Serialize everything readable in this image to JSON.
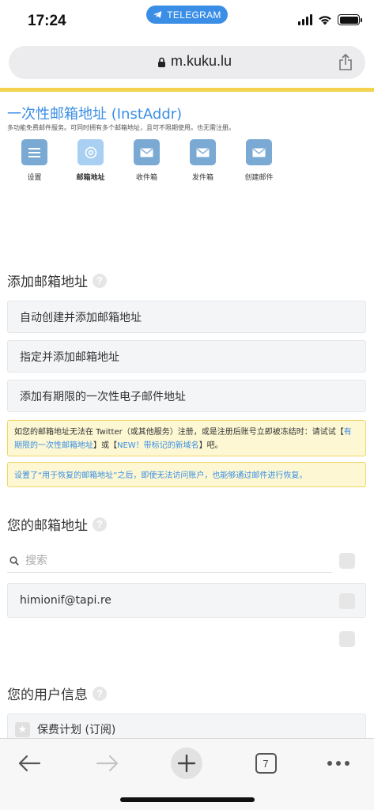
{
  "status_bar": {
    "time": "17:24",
    "telegram_label": "TELEGRAM",
    "battery_level": 1.0
  },
  "browser": {
    "url": "m.kuku.lu",
    "tab_count": "7"
  },
  "header": {
    "title": "一次性邮箱地址 (InstAddr)",
    "subtitle": "多功能免费邮件服务。可同时拥有多个邮箱地址，且可不限期使用。也无需注册。"
  },
  "nav": [
    {
      "label": "设置",
      "icon": "menu-icon"
    },
    {
      "label": "邮箱地址",
      "icon": "at-icon"
    },
    {
      "label": "收件箱",
      "icon": "mail-icon"
    },
    {
      "label": "发件箱",
      "icon": "mail-icon"
    },
    {
      "label": "创建邮件",
      "icon": "mail-icon"
    }
  ],
  "add_section": {
    "heading": "添加邮箱地址",
    "buttons": [
      "自动创建并添加邮箱地址",
      "指定并添加邮箱地址",
      "添加有期限的一次性电子邮件地址"
    ]
  },
  "notices": {
    "first_prefix": "如您的邮箱地址无法在 Twitter（或其他服务）注册，或是注册后账号立即被冻结时：请试试【",
    "first_link1": "有期限的一次性邮箱地址",
    "first_middle": "】或【",
    "first_link2": "NEW！带标记的新域名",
    "first_suffix": "】吧。",
    "second": "设置了“用于恢复的邮箱地址”之后，即使无法访问账户，也能够通过邮件进行恢复。"
  },
  "mailbox_section": {
    "heading": "您的邮箱地址",
    "search_placeholder": "搜索",
    "emails": [
      "himionif@tapi.re"
    ]
  },
  "user_section": {
    "heading": "您的用户信息",
    "plan_label": "保费计划 (订阅)"
  },
  "colors": {
    "accent": "#3a8ee6",
    "yellow_bar": "#f3d250",
    "notice_bg": "#fdf8d3"
  }
}
